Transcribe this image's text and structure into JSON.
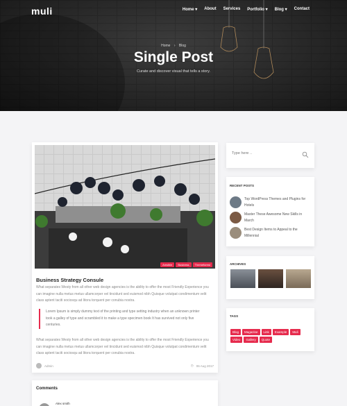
{
  "header": {
    "logo": "muli",
    "nav": [
      "Home ▾",
      "About",
      "Services",
      "Portfolio ▾",
      "Blog ▾",
      "Contact"
    ]
  },
  "hero": {
    "breadcrumb": [
      "Home",
      "›",
      "Blog"
    ],
    "title": "Single Post",
    "subtitle": "Curate and discover visual that tells a story."
  },
  "post": {
    "image_tags": [
      "Amsible",
      "Business",
      "Themeforest"
    ],
    "title": "Business Strategy Consule",
    "paragraph1": "What separates Westy from all other web design agencies is the ability to offer the most Friendly Experience you can imagine nulla metus metus ullamcorper vel tincidunt sed euismod nibh Quisque volutpat condimentum velit class aptent taciti sociosqu ad litora torquent per conubia nostra.",
    "quote": "Lorem Ipsum is simply dummy text of the printing and type setting industry when an unknown printer took a galley of type and scrambled it to make a type specimen book It has survived not only five centuries.",
    "paragraph2": "What separates Westy from all other web design agencies is the ability to offer the most Friendly Experience you can imagine nulla metus metus ullamcorper vel tincidunt sed euismod nibh Quisque volutpat condimentum velit class aptent taciti sociosqu ad litora torquent per conubia nostra.",
    "author": "Admin",
    "date": "06 Aug 2017"
  },
  "comments": {
    "title": "Comments",
    "first_name": "Alex smith"
  },
  "sidebar": {
    "search_placeholder": "Type here ..",
    "recent_title": "RECENT POSTS",
    "recent": [
      "Top WordPress Themes and Plugins for Hotels",
      "Master These Awesome New Skills in March",
      "Best Design Items to Appeal to the Millennial"
    ],
    "archives_title": "ARCHIVES",
    "tags_title": "TAGS",
    "tags": [
      "Blog",
      "Magazine",
      "Link",
      "Example",
      "Muli",
      "Video",
      "Gallery",
      "Quote"
    ]
  },
  "colors": {
    "accent": "#e62b4d"
  }
}
